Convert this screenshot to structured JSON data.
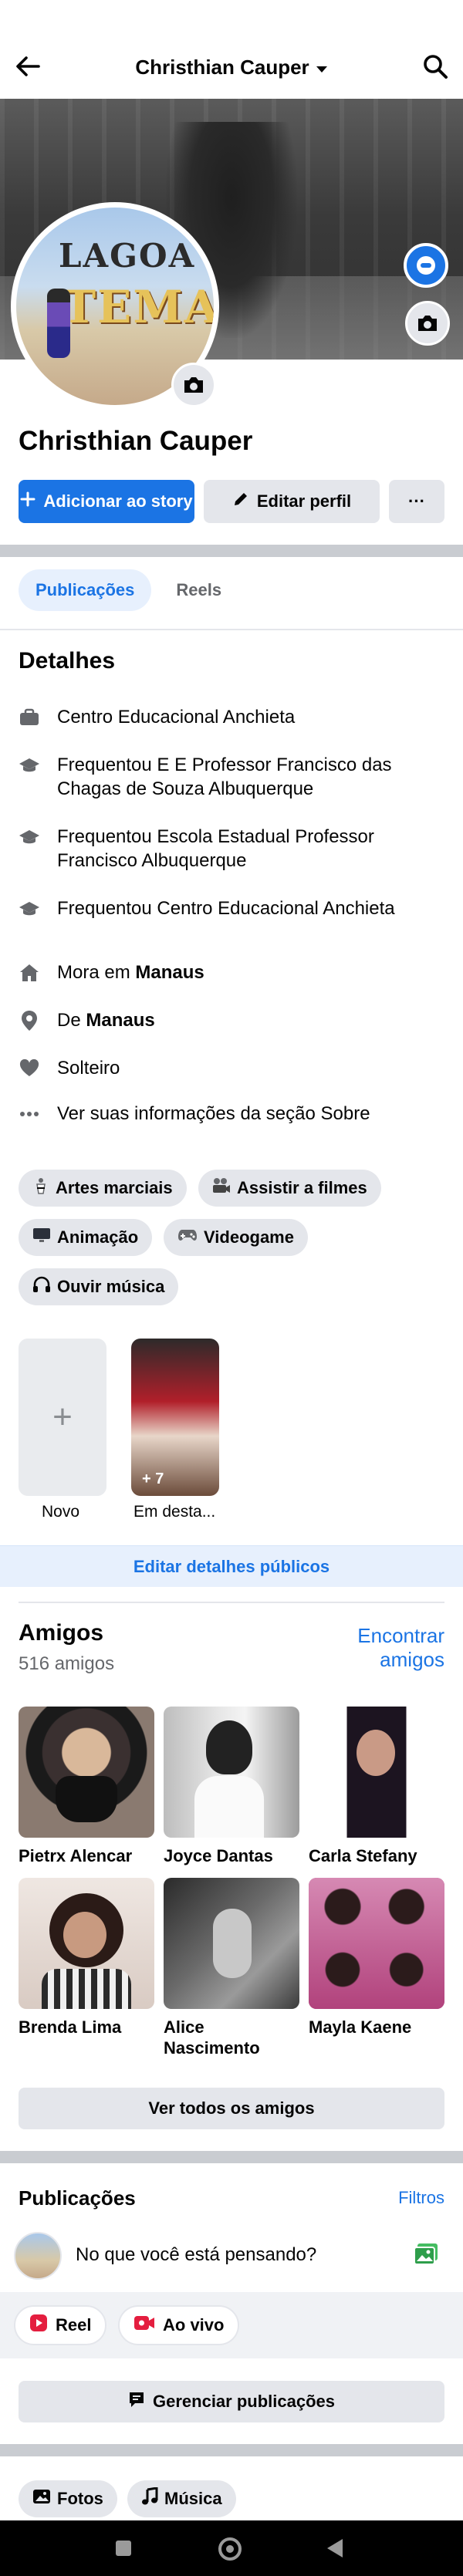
{
  "header": {
    "title": "Christhian Cauper"
  },
  "profile": {
    "name": "Christhian Cauper",
    "avatar_text_top": "LAGOA",
    "avatar_text_bottom": "TEMAS"
  },
  "actions": {
    "add_story": "Adicionar ao story",
    "edit_profile": "Editar perfil",
    "more": "···"
  },
  "tabs": [
    {
      "label": "Publicações",
      "active": true
    },
    {
      "label": "Reels",
      "active": false
    }
  ],
  "details": {
    "title": "Detalhes",
    "items": [
      {
        "icon": "briefcase-icon",
        "text": "Centro Educacional Anchieta"
      },
      {
        "icon": "graduation-cap-icon",
        "text": "Frequentou E E Professor Francisco das Chagas de Souza Albuquerque"
      },
      {
        "icon": "graduation-cap-icon",
        "text": "Frequentou Escola Estadual Professor Francisco Albuquerque"
      },
      {
        "icon": "graduation-cap-icon",
        "text": "Frequentou Centro Educacional Anchieta"
      },
      {
        "icon": "home-icon",
        "prefix": "Mora em ",
        "bold": "Manaus"
      },
      {
        "icon": "location-pin-icon",
        "prefix": "De ",
        "bold": "Manaus"
      },
      {
        "icon": "heart-icon",
        "text": "Solteiro"
      },
      {
        "icon": "ellipsis-icon",
        "text": "Ver suas informações da seção Sobre"
      }
    ]
  },
  "interests": [
    {
      "icon": "martial-arts-icon",
      "label": "Artes marciais"
    },
    {
      "icon": "film-camera-icon",
      "label": "Assistir a filmes"
    },
    {
      "icon": "monitor-icon",
      "label": "Animação"
    },
    {
      "icon": "gamepad-icon",
      "label": "Videogame"
    },
    {
      "icon": "headphones-icon",
      "label": "Ouvir música"
    }
  ],
  "highlights": {
    "new_label": "Novo",
    "featured_label": "Em desta...",
    "featured_count": "+ 7"
  },
  "edit_public_details": "Editar detalhes públicos",
  "friends": {
    "title": "Amigos",
    "count": "516 amigos",
    "find": "Encontrar amigos",
    "list": [
      {
        "name": "Pietrx Alencar"
      },
      {
        "name": "Joyce Dantas"
      },
      {
        "name": "Carla Stefany"
      },
      {
        "name": "Brenda Lima"
      },
      {
        "name": "Alice Nascimento"
      },
      {
        "name": "Mayla Kaene"
      }
    ],
    "see_all": "Ver todos os amigos"
  },
  "posts": {
    "title": "Publicações",
    "filters": "Filtros",
    "composer_placeholder": "No que você está pensando?",
    "reel": "Reel",
    "live": "Ao vivo",
    "manage": "Gerenciar publicações"
  },
  "bottom_chips": [
    {
      "icon": "photos-icon",
      "label": "Fotos"
    },
    {
      "icon": "music-note-icon",
      "label": "Música"
    }
  ],
  "colors": {
    "accent": "#1b74e4",
    "accent_light": "#e7f0fd",
    "button_gray": "#e4e6eb",
    "secondary_text": "#65676b"
  }
}
